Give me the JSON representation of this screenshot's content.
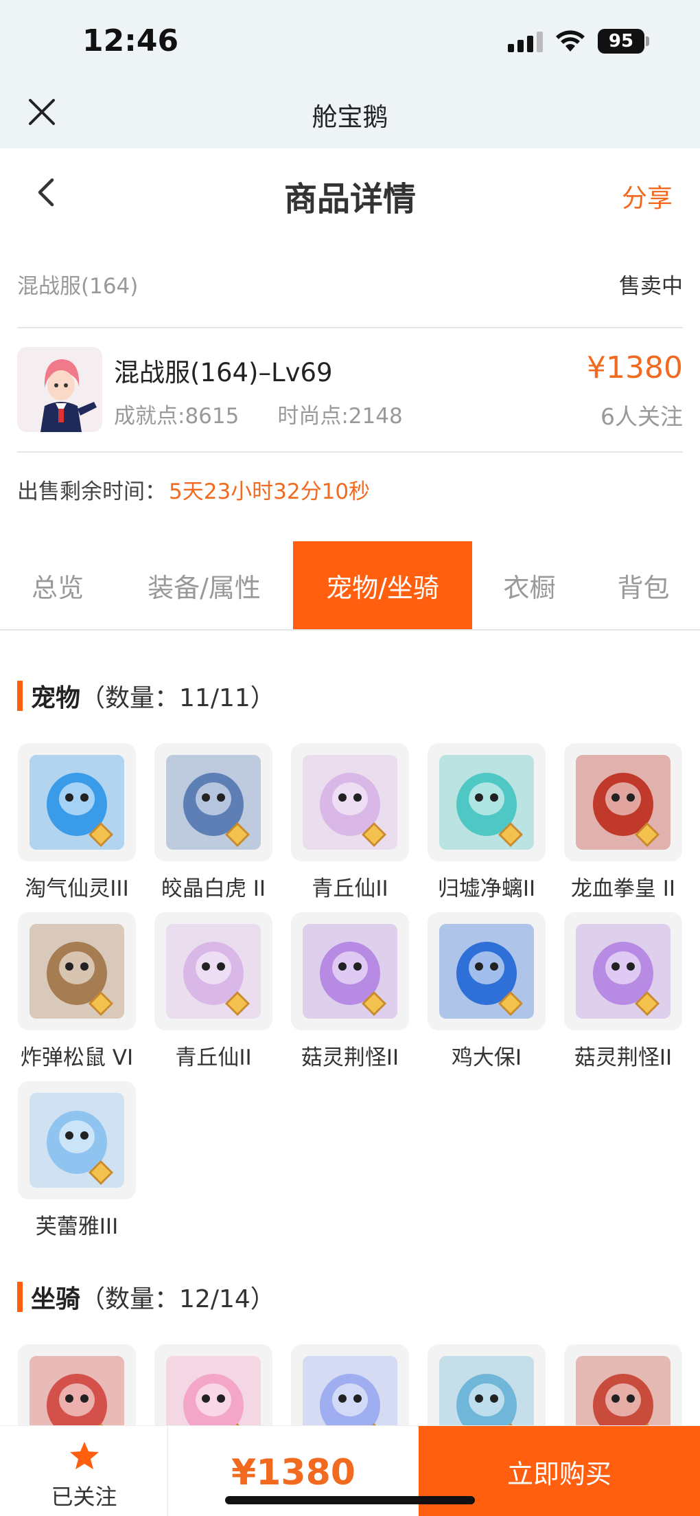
{
  "status_bar": {
    "time": "12:46",
    "battery": "95"
  },
  "mini_program": {
    "title": "舱宝鹅"
  },
  "nav": {
    "title": "商品详情",
    "share": "分享"
  },
  "server": {
    "name": "混战服(164)",
    "status": "售卖中"
  },
  "product": {
    "title": "混战服(164)–Lv69",
    "achievement": "成就点:8615",
    "fashion": "时尚点:2148",
    "price": "¥1380",
    "followers": "6人关注"
  },
  "remaining": {
    "label": "出售剩余时间：",
    "value": "5天23小时32分10秒"
  },
  "tabs": [
    {
      "label": "总览",
      "active": false
    },
    {
      "label": "装备/属性",
      "active": false
    },
    {
      "label": "宠物/坐骑",
      "active": true
    },
    {
      "label": "衣橱",
      "active": false
    },
    {
      "label": "背包",
      "active": false
    }
  ],
  "pets_section": {
    "title": "宠物",
    "count": "（数量：11/11）"
  },
  "pets": [
    {
      "name": "淘气仙灵III",
      "icon": "blue-puppy-icon",
      "color": "#3a9be8"
    },
    {
      "name": "皎晶白虎 II",
      "icon": "white-tiger-icon",
      "color": "#5d7fb5"
    },
    {
      "name": "青丘仙II",
      "icon": "fox-fairy-icon",
      "color": "#d9b7e6"
    },
    {
      "name": "归墟净螭II",
      "icon": "cyan-dragon-icon",
      "color": "#4fc7c4"
    },
    {
      "name": "龙血拳皇 II",
      "icon": "red-dragon-icon",
      "color": "#c0392b"
    },
    {
      "name": "炸弹松鼠 VI",
      "icon": "squirrel-icon",
      "color": "#a67c52"
    },
    {
      "name": "青丘仙II",
      "icon": "fox-fairy-icon",
      "color": "#d9b7e6"
    },
    {
      "name": "菇灵荆怪II",
      "icon": "mushroom-elf-icon",
      "color": "#b78be3"
    },
    {
      "name": "鸡大保I",
      "icon": "blue-chick-icon",
      "color": "#2f6fd8"
    },
    {
      "name": "菇灵荆怪II",
      "icon": "mushroom-elf-icon",
      "color": "#b78be3"
    },
    {
      "name": "芙蕾雅III",
      "icon": "valkyrie-icon",
      "color": "#8fc3f0"
    }
  ],
  "mounts_section": {
    "title": "坐骑",
    "count": "（数量：12/14）"
  },
  "mounts": [
    {
      "icon": "red-dragon-mount-icon",
      "color": "#d4504a"
    },
    {
      "icon": "pink-candy-mount-icon",
      "color": "#f3a6c8"
    },
    {
      "icon": "ice-wolf-mount-icon",
      "color": "#9eaef0"
    },
    {
      "icon": "fish-mount-icon",
      "color": "#6fb6d8"
    },
    {
      "icon": "carriage-mount-icon",
      "color": "#c94b3c"
    }
  ],
  "bottom": {
    "follow_label": "已关注",
    "price": "¥1380",
    "buy_label": "立即购买"
  },
  "colors": {
    "accent": "#ff5f0f",
    "price": "#f26a1f"
  }
}
